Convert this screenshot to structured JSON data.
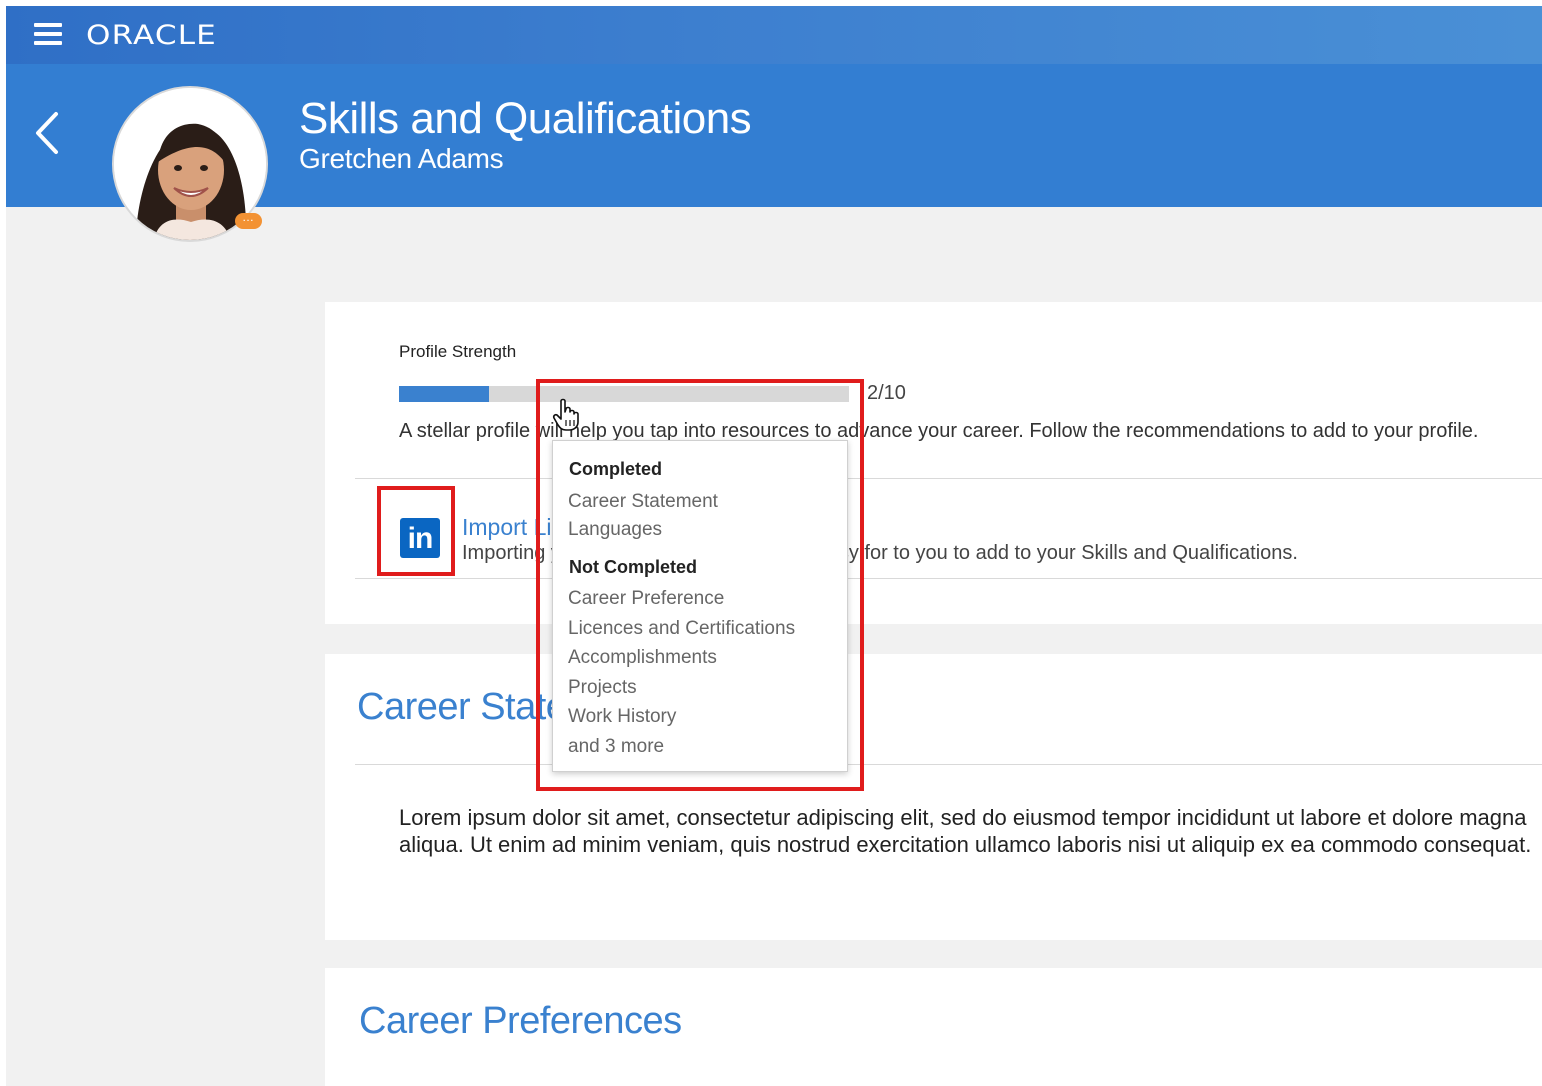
{
  "app": {
    "brand": "ORACLE"
  },
  "header": {
    "title": "Skills and Qualifications",
    "subtitle": "Gretchen Adams",
    "badge": "…"
  },
  "profile_strength": {
    "label": "Profile Strength",
    "completed": 2,
    "total": 10,
    "count_text": "2/10",
    "description": "A stellar profile will help you tap into resources to advance your career. Follow the recommendations to add to your profile."
  },
  "linkedin_import": {
    "link_text": "Import LinkedIn Profile",
    "description": "Importing your LinkedIn profile makes it easy for to you to add to your Skills and Qualifications."
  },
  "popover": {
    "completed_heading": "Completed",
    "completed_items": [
      "Career Statement",
      "Languages"
    ],
    "not_completed_heading": "Not Completed",
    "not_completed_items": [
      "Career Preference",
      "Licences and Certifications",
      "Accomplishments",
      "Projects",
      "Work History",
      "and 3 more"
    ]
  },
  "career_statement": {
    "title": "Career Statement",
    "body": "Lorem ipsum dolor sit amet, consectetur adipiscing elit, sed do eiusmod tempor incididunt ut labore et dolore magna aliqua. Ut enim ad minim veniam, quis nostrud exercitation ullamco laboris nisi ut aliquip ex ea commodo consequat."
  },
  "career_preferences": {
    "title": "Career Preferences"
  },
  "colors": {
    "accent": "#3a81cf",
    "header": "#337ed2",
    "highlight": "#e01c1c",
    "linkedin": "#0a66c2"
  }
}
